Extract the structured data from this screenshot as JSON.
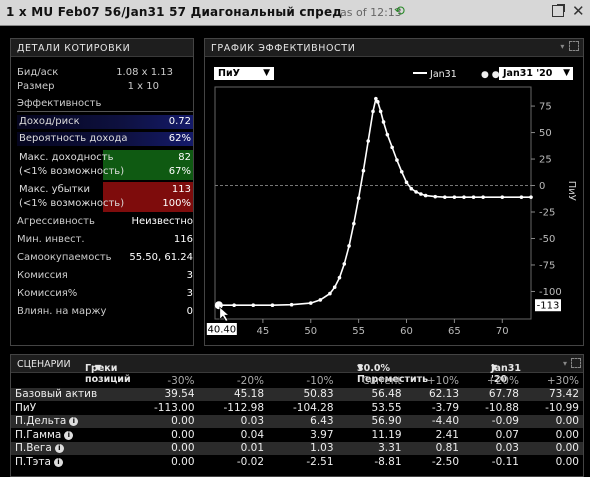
{
  "window": {
    "title": "1 x MU Feb07 56/Jan31 57 Диагональный спред",
    "as_of": "as of 12:13"
  },
  "quote": {
    "header": "ДЕТАЛИ КОТИРОВКИ",
    "bid_ask_label": "Бид/аск",
    "bid_ask_value": "1.08 x 1.13",
    "size_label": "Размер",
    "size_value": "1 x 10",
    "efficiency_label": "Эффективность",
    "reward_risk_label": "Доход/риск",
    "reward_risk_value": "0.72",
    "prob_profit_label": "Вероятность дохода",
    "prob_profit_value": "62%",
    "max_profit_label1": "Макс. доходность",
    "max_profit_value1": "82",
    "max_profit_label2": "(<1% возможность)",
    "max_profit_value2": "67%",
    "max_loss_label1": "Макс. убытки",
    "max_loss_value1": "113",
    "max_loss_label2": "(<1% возможность)",
    "max_loss_value2": "100%",
    "aggr_label": "Агрессивность",
    "aggr_value": "Неизвестно",
    "min_inv_label": "Мин. инвест.",
    "min_inv_value": "116",
    "breakeven_label": "Самоокупаемость",
    "breakeven_value": "55.50, 61.24",
    "commission_label": "Комиссия",
    "commission_value": "3",
    "commission_pct_label": "Комиссия%",
    "commission_pct_value": "3",
    "margin_label": "Влиян. на маржу",
    "margin_value": "0"
  },
  "performance": {
    "header": "ГРАФИК ЭФФЕКТИВНОСТИ",
    "metric_dropdown": "ПиУ",
    "legend_solid": "Jan31",
    "legend_dotted_dropdown": "Jan31 '20",
    "cursor_label": "40.40",
    "cursor_value": "-113"
  },
  "chart_data": {
    "type": "line",
    "ylabel": "ПиУ",
    "xlim": [
      40,
      73
    ],
    "ylim": [
      -126,
      93
    ],
    "x_ticks": [
      45,
      50,
      55,
      60,
      65,
      70
    ],
    "y_ticks": [
      75,
      50,
      25,
      0,
      -25,
      -50,
      -75,
      -100
    ],
    "zero_line": true,
    "series": [
      {
        "name": "Jan31 '20",
        "style": "dotted",
        "color": "#ffffff",
        "x": [
          40.4,
          42,
          44,
          46,
          48,
          50,
          51,
          52,
          52.5,
          53,
          53.5,
          54,
          54.5,
          55,
          55.5,
          56,
          56.5,
          56.8,
          57,
          57.3,
          57.6,
          58,
          58.5,
          59,
          59.5,
          60,
          60.5,
          61,
          61.5,
          62,
          63,
          64,
          65,
          66,
          67,
          68,
          70,
          72,
          73
        ],
        "y": [
          -113,
          -113,
          -113,
          -113,
          -112.5,
          -111,
          -108,
          -102,
          -96,
          -87,
          -74,
          -57,
          -36,
          -12,
          14,
          42,
          70,
          82,
          79,
          70,
          60,
          48,
          36,
          24,
          13,
          3,
          -3,
          -6,
          -8,
          -9.5,
          -10.5,
          -11,
          -11,
          -11,
          -11,
          -11,
          -11,
          -11,
          -11
        ]
      }
    ]
  },
  "scenarios": {
    "header": "СЦЕНАРИИ",
    "greeks_dropdown": "Греки позиций",
    "shift_dropdown": "30.0% Переместить",
    "expiry_dropdown": "Jan31 '20",
    "columns": [
      "-30%",
      "-20%",
      "-10%",
      "Current",
      "+10%",
      "+20%",
      "+30%"
    ],
    "rows": [
      {
        "label": "Базовый актив",
        "info": false,
        "values": [
          "39.54",
          "45.18",
          "50.83",
          "56.48",
          "62.13",
          "67.78",
          "73.42"
        ]
      },
      {
        "label": "ПиУ",
        "info": false,
        "values": [
          "-113.00",
          "-112.98",
          "-104.28",
          "53.55",
          "-3.79",
          "-10.88",
          "-10.99"
        ]
      },
      {
        "label": "П.Дельта",
        "info": true,
        "values": [
          "0.00",
          "0.03",
          "6.43",
          "56.90",
          "-4.40",
          "-0.09",
          "0.00"
        ]
      },
      {
        "label": "П.Гамма",
        "info": true,
        "values": [
          "0.00",
          "0.04",
          "3.97",
          "11.19",
          "2.41",
          "0.07",
          "0.00"
        ]
      },
      {
        "label": "П.Вега",
        "info": true,
        "values": [
          "0.00",
          "0.01",
          "1.03",
          "3.31",
          "0.81",
          "0.03",
          "0.00"
        ]
      },
      {
        "label": "П.Тэта",
        "info": true,
        "values": [
          "0.00",
          "-0.02",
          "-2.51",
          "-8.81",
          "-2.50",
          "-0.11",
          "0.00"
        ]
      }
    ]
  },
  "colors": {
    "reward_risk_bg": "#141a6a",
    "max_profit_bg": "#0f5a12",
    "max_loss_bg": "#7e0c0c",
    "titlebar_bg": "#d7d7d7"
  }
}
